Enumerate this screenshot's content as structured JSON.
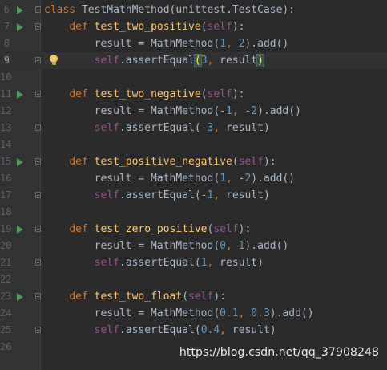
{
  "editor": {
    "lines": [
      {
        "num": "6",
        "text": "class TestMathMethod(unittest.TestCase):"
      },
      {
        "num": "7",
        "text": "    def test_two_positive(self):"
      },
      {
        "num": "8",
        "text": "        result = MathMethod(1, 2).add()"
      },
      {
        "num": "9",
        "text": "        self.assertEqual(3, result)"
      },
      {
        "num": "10",
        "text": ""
      },
      {
        "num": "11",
        "text": "    def test_two_negative(self):"
      },
      {
        "num": "12",
        "text": "        result = MathMethod(-1, -2).add()"
      },
      {
        "num": "13",
        "text": "        self.assertEqual(-3, result)"
      },
      {
        "num": "14",
        "text": ""
      },
      {
        "num": "15",
        "text": "    def test_positive_negative(self):"
      },
      {
        "num": "16",
        "text": "        result = MathMethod(1, -2).add()"
      },
      {
        "num": "17",
        "text": "        self.assertEqual(-1, result)"
      },
      {
        "num": "18",
        "text": ""
      },
      {
        "num": "19",
        "text": "    def test_zero_positive(self):"
      },
      {
        "num": "20",
        "text": "        result = MathMethod(0, 1).add()"
      },
      {
        "num": "21",
        "text": "        self.assertEqual(1, result)"
      },
      {
        "num": "22",
        "text": ""
      },
      {
        "num": "23",
        "text": "    def test_two_float(self):"
      },
      {
        "num": "24",
        "text": "        result = MathMethod(0.1, 0.3).add()"
      },
      {
        "num": "25",
        "text": "        self.assertEqual(0.4, result)"
      },
      {
        "num": "26",
        "text": ""
      }
    ],
    "current_line": "9",
    "run_markers": [
      "6",
      "7",
      "11",
      "15",
      "19",
      "23"
    ],
    "fold_markers": [
      "6",
      "7",
      "9",
      "11",
      "13",
      "15",
      "17",
      "19",
      "21",
      "23",
      "25"
    ],
    "intention_bulb_line": "9"
  },
  "watermark": "https://blog.csdn.net/qq_37908248",
  "icons": {
    "run": "run-test-icon",
    "fold": "fold-icon",
    "bulb": "intention-bulb-icon"
  },
  "colors": {
    "background": "#2b2b2b",
    "gutter": "#313335",
    "keyword": "#cc7832",
    "function": "#ffc66d",
    "self": "#94558d",
    "number": "#6897bb",
    "text": "#a9b7c6",
    "run_icon": "#499c54",
    "bulb": "#f2c55c"
  }
}
